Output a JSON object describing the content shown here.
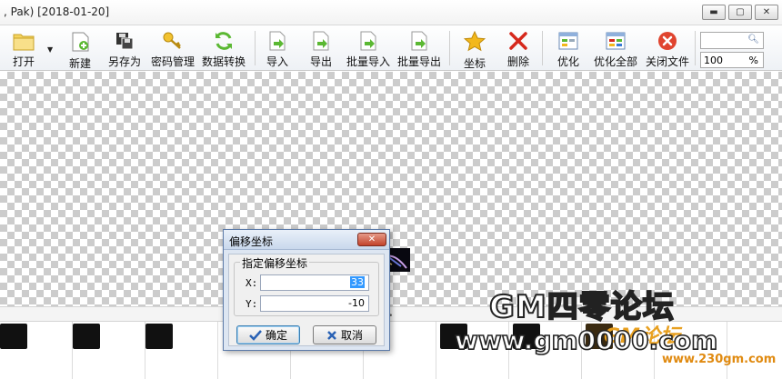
{
  "window": {
    "title": ", Pak) [2018-01-20]",
    "controls": {
      "minimize": "▬",
      "maximize": "▢",
      "close": "✕"
    }
  },
  "toolbar": {
    "items": [
      {
        "id": "open",
        "label": "打开",
        "icon": "folder-icon"
      },
      {
        "id": "new",
        "label": "新建",
        "icon": "new-file-icon"
      },
      {
        "id": "save_as",
        "label": "另存为",
        "icon": "save-as-icon"
      },
      {
        "id": "password",
        "label": "密码管理",
        "icon": "key-icon"
      },
      {
        "id": "convert",
        "label": "数据转换",
        "icon": "refresh-icon"
      },
      {
        "id": "import",
        "label": "导入",
        "icon": "import-icon"
      },
      {
        "id": "export",
        "label": "导出",
        "icon": "export-icon"
      },
      {
        "id": "batch_import",
        "label": "批量导入",
        "icon": "batch-import-icon"
      },
      {
        "id": "batch_export",
        "label": "批量导出",
        "icon": "batch-export-icon"
      },
      {
        "id": "coords",
        "label": "坐标",
        "icon": "star-icon"
      },
      {
        "id": "delete",
        "label": "删除",
        "icon": "delete-x-icon"
      },
      {
        "id": "optimize",
        "label": "优化",
        "icon": "optimize-icon"
      },
      {
        "id": "optimize_all",
        "label": "优化全部",
        "icon": "optimize-all-icon"
      },
      {
        "id": "close_file",
        "label": "关闭文件",
        "icon": "close-file-icon"
      }
    ],
    "zoom": {
      "value": "100",
      "unit": "%"
    },
    "search": {
      "icon": "search-icon"
    },
    "colors": {
      "accent_green": "#5bb833",
      "delete_red": "#d6281c",
      "star_gold": "#f2b81c"
    }
  },
  "dialog": {
    "title": "偏移坐标",
    "close": "✕",
    "group_label": "指定偏移坐标",
    "x_label": "X:",
    "x_value": "33",
    "y_label": "Y:",
    "y_value": "-10",
    "ok_label": "确定",
    "cancel_label": "取消"
  },
  "watermark": {
    "line1": "GM四零论坛",
    "line2": "www.gm0000.com",
    "line3": "GM论坛",
    "line4": "www.230gm.com"
  }
}
